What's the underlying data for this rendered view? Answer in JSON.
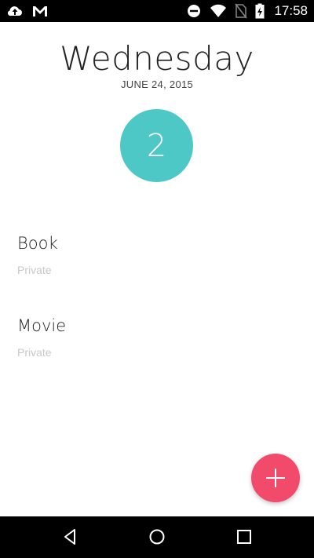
{
  "status_bar": {
    "icons_left": [
      "cloud-upload-icon",
      "gmail-icon"
    ],
    "icons_right": [
      "do-not-disturb-icon",
      "wifi-icon",
      "no-sim-icon",
      "battery-charging-icon"
    ],
    "time": "17:58"
  },
  "header": {
    "day": "Wednesday",
    "date": "JUNE 24, 2015",
    "count": "2",
    "count_color": "#4ec8c6"
  },
  "items": [
    {
      "title": "Book",
      "subtitle": "Private"
    },
    {
      "title": "Movie",
      "subtitle": "Private"
    }
  ],
  "fab": {
    "icon": "plus-icon",
    "color": "#f24a6a"
  },
  "nav_bar": {
    "icons": [
      "back-icon",
      "home-icon",
      "recents-icon"
    ]
  }
}
